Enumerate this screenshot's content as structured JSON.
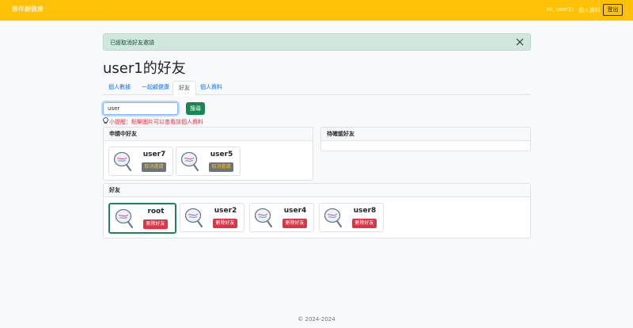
{
  "navbar": {
    "brand": "夥伴顧健康",
    "greeting": "Hi, user1!",
    "profile_link": "個人資料",
    "logout_label": "登出",
    "color": "#ffc107"
  },
  "alert": {
    "message": "已經取消好友邀請"
  },
  "page_title": "user1的好友",
  "tabs": [
    {
      "label": "個人數據",
      "active": false
    },
    {
      "label": "一起顧健康",
      "active": false
    },
    {
      "label": "好友",
      "active": true
    },
    {
      "label": "個人資料",
      "active": false
    }
  ],
  "search": {
    "value": "user",
    "button_label": "搜尋"
  },
  "tip": "小提醒：點擊圖片可以查看該個人資料",
  "pending_sent": {
    "header": "申請中好友",
    "users": [
      {
        "name": "user7",
        "action": "取消邀請"
      },
      {
        "name": "user5",
        "action": "取消邀請"
      }
    ]
  },
  "pending_received": {
    "header": "待確認好友"
  },
  "friends": {
    "header": "好友",
    "users": [
      {
        "name": "root",
        "action": "刪除好友"
      },
      {
        "name": "user2",
        "action": "刪除好友"
      },
      {
        "name": "user4",
        "action": "刪除好友"
      },
      {
        "name": "user8",
        "action": "刪除好友"
      }
    ]
  },
  "footer": "© 2024-2024",
  "colors": {
    "success": "#198754",
    "danger": "#dc3545",
    "secondary": "#6c757d",
    "primary": "#0d6efd"
  }
}
